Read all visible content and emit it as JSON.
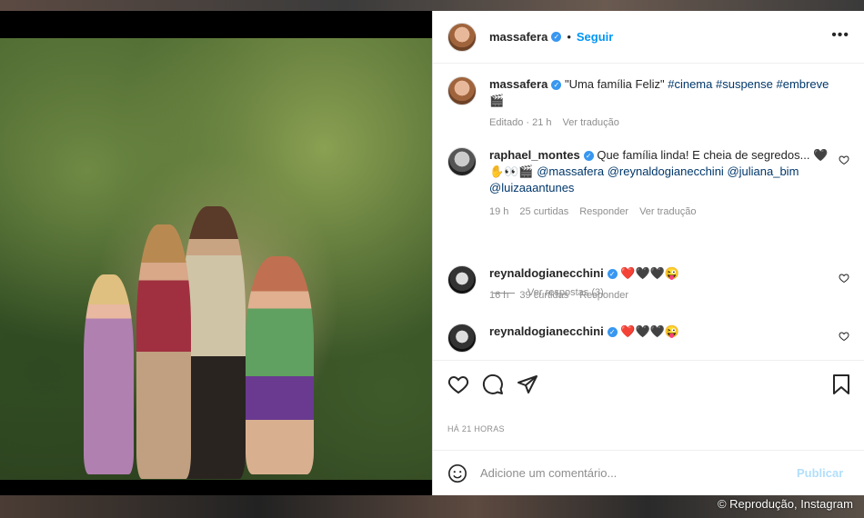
{
  "post": {
    "username": "massafera",
    "follow_label": "Seguir",
    "more_label": "•••",
    "caption": "\"Uma família Feliz\"",
    "hashtags": [
      "#cinema",
      "#suspense",
      "#embreve"
    ],
    "caption_emoji": "🎬",
    "edited_label": "Editado · 21 h",
    "translate_label": "Ver tradução",
    "timestamp": "HÁ 21 HORAS"
  },
  "comments": [
    {
      "username": "raphael_montes",
      "text": "Que família linda! E cheia de segredos... 🖤",
      "line2_emoji": "✋👀🎬",
      "mentions": [
        "@massafera",
        "@reynaldogianecchini",
        "@juliana_bim",
        "@luizaaantunes"
      ],
      "time": "19 h",
      "likes": "25 curtidas",
      "reply": "Responder",
      "translate": "Ver tradução",
      "view_replies": "Ver respostas (3)"
    },
    {
      "username": "reynaldogianecchini",
      "text": "❤️🖤🖤😜",
      "time": "16 h",
      "likes": "39 curtidas",
      "reply": "Responder"
    },
    {
      "username": "reynaldogianecchini",
      "text": "❤️🖤🖤😜"
    }
  ],
  "add_comment": {
    "placeholder": "Adicione um comentário...",
    "publish_label": "Publicar"
  },
  "credit": "© Reprodução, Instagram",
  "colors": {
    "link_blue": "#0095f6",
    "mention_blue": "#00376b",
    "muted": "#8e8e8e",
    "publish_disabled": "#b2dffc"
  }
}
